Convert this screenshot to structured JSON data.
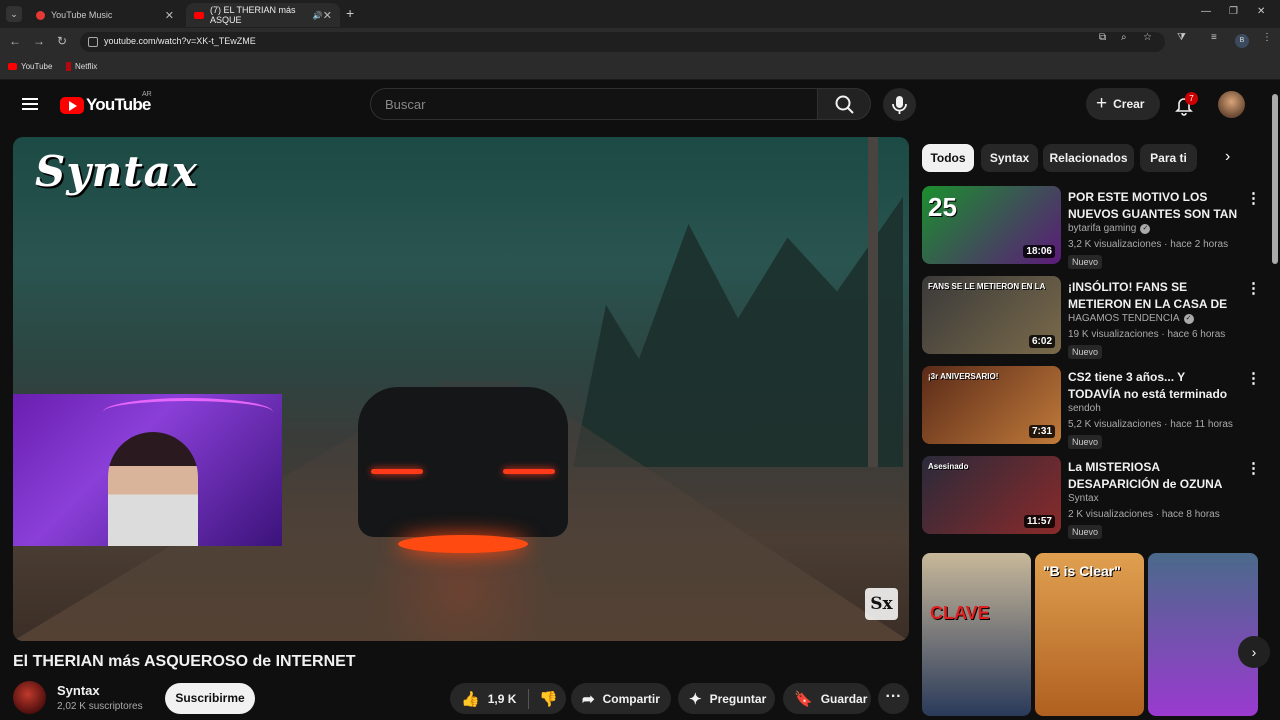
{
  "browser": {
    "tabs": [
      {
        "label": "YouTube Music"
      },
      {
        "label": "(7) EL THERIAN más ASQUE"
      }
    ],
    "url": "youtube.com/watch?v=XK-t_TEwZME",
    "profile_initial": "B",
    "bookmarks": [
      {
        "label": "YouTube"
      },
      {
        "label": "Netflix"
      }
    ]
  },
  "header": {
    "logo_text": "YouTube",
    "country_code": "AR",
    "search_placeholder": "Buscar",
    "create_label": "Crear",
    "notification_count": "7"
  },
  "player": {
    "brand_overlay": "Syntax",
    "watermark": "Sx"
  },
  "video": {
    "title": "El THERIAN más ASQUEROSO de INTERNET",
    "channel": "Syntax",
    "subscribers": "2,02 K suscriptores",
    "subscribe_label": "Suscribirme",
    "likes": "1,9 K",
    "share_label": "Compartir",
    "ask_label": "Preguntar",
    "save_label": "Guardar"
  },
  "sidebar": {
    "chips": [
      {
        "label": "Todos",
        "active": true
      },
      {
        "label": "Syntax",
        "active": false
      },
      {
        "label": "Relacionados",
        "active": false
      },
      {
        "label": "Para ti",
        "active": false
      }
    ],
    "recommendations": [
      {
        "title": "POR ESTE MOTIVO LOS NUEVOS GUANTES SON TAN ...",
        "channel": "bytarifa gaming",
        "verified": true,
        "meta": "3,2 K visualizaciones · hace 2 horas",
        "badge": "Nuevo",
        "duration": "18:06",
        "thumb_text": "25",
        "thumb_colors": [
          "#1b8f2e",
          "#5c1a7a"
        ]
      },
      {
        "title": "¡INSÓLITO! FANS SE METIERON EN LA CASA DE GONCHO Y SE...",
        "channel": "HAGAMOS TENDENCIA",
        "verified": true,
        "meta": "19 K visualizaciones · hace 6 horas",
        "badge": "Nuevo",
        "duration": "6:02",
        "thumb_text": "FANS SE LE METIERON EN LA",
        "thumb_colors": [
          "#3a3a3a",
          "#7a6a4a"
        ]
      },
      {
        "title": "CS2 tiene 3 años... Y TODAVÍA no está terminado",
        "channel": "sendoh",
        "verified": false,
        "meta": "5,2 K visualizaciones · hace 11 horas",
        "badge": "Nuevo",
        "duration": "7:31",
        "thumb_text": "¡3r ANIVERSARIO!",
        "thumb_colors": [
          "#5a2a18",
          "#c07a3a"
        ]
      },
      {
        "title": "La MISTERIOSA DESAPARICIÓN de OZUNA",
        "channel": "Syntax",
        "verified": false,
        "meta": "2 K visualizaciones · hace 8 horas",
        "badge": "Nuevo",
        "duration": "11:57",
        "thumb_text": "Asesinado",
        "thumb_colors": [
          "#2a2a3a",
          "#8a2a2a"
        ]
      }
    ],
    "shorts": [
      {
        "text": "CLAVE",
        "colors": [
          "#c8b89a",
          "#2a3a5a"
        ]
      },
      {
        "text": "\"B is Clear\"",
        "colors": [
          "#e0a050",
          "#b06020"
        ]
      },
      {
        "text": "",
        "colors": [
          "#4a6a8a",
          "#9a3ad0"
        ]
      }
    ]
  },
  "colors": {
    "accent": "#ff0000",
    "background": "#0f0f0f",
    "chip_bg": "#272727"
  }
}
